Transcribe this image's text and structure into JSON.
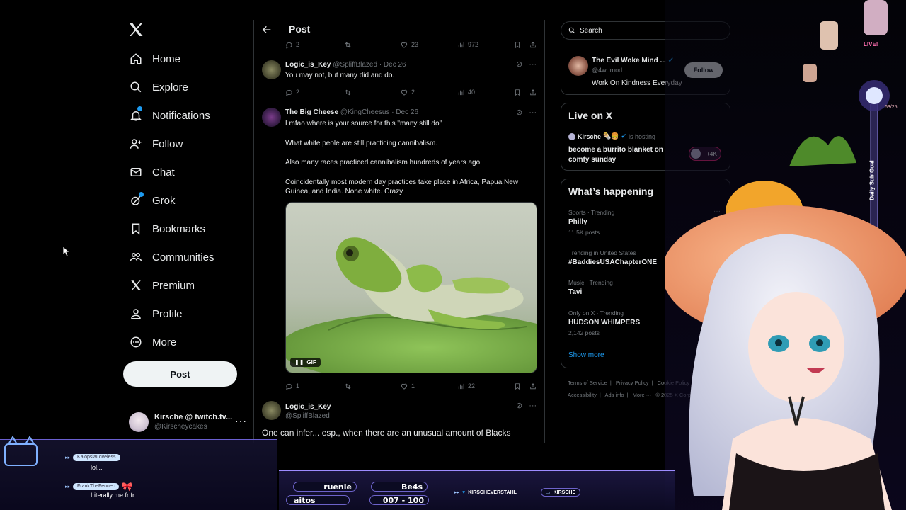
{
  "nav": {
    "items": [
      {
        "label": "Home",
        "icon": "home-icon"
      },
      {
        "label": "Explore",
        "icon": "search-icon"
      },
      {
        "label": "Notifications",
        "icon": "bell-icon",
        "badge": "1"
      },
      {
        "label": "Follow",
        "icon": "follow-icon"
      },
      {
        "label": "Chat",
        "icon": "mail-icon"
      },
      {
        "label": "Grok",
        "icon": "grok-icon"
      },
      {
        "label": "Bookmarks",
        "icon": "bookmark-icon"
      },
      {
        "label": "Communities",
        "icon": "communities-icon"
      },
      {
        "label": "Premium",
        "icon": "x-logo-icon"
      },
      {
        "label": "Profile",
        "icon": "person-icon"
      },
      {
        "label": "More",
        "icon": "more-circle-icon"
      }
    ],
    "post_label": "Post",
    "account": {
      "name": "Kirsche @ twitch.tv...",
      "handle": "@Kirscheycakes"
    }
  },
  "header": {
    "title": "Post"
  },
  "top_actions": {
    "replies": "2",
    "reposts": "",
    "likes": "23",
    "views": "972"
  },
  "tweets": [
    {
      "name": "Logic_is_Key",
      "meta": "@SpliffBlazed · Dec 26",
      "text": "You may not, but many did and do.",
      "actions": {
        "replies": "2",
        "likes": "2",
        "views": "40"
      }
    },
    {
      "name": "The Big Cheese",
      "meta": "@KingCheesus · Dec 26",
      "paragraphs": [
        "Lmfao where is your source for this \"many still do\"",
        "What white peole are still practicing cannibalism.",
        "Also many races practiced cannibalism hundreds of years ago.",
        "Coincidentally most modern day practices take place in Africa, Papua New Guinea, and India. None white. Crazy"
      ],
      "gif_label": "GIF",
      "actions": {
        "replies": "1",
        "likes": "1",
        "views": "22"
      }
    },
    {
      "name": "Logic_is_Key",
      "meta": "@SpliffBlazed",
      "text": "One can infer... esp., when there are an unusual amount of Blacks"
    }
  ],
  "search": {
    "placeholder": "Search"
  },
  "who_to_follow": {
    "name": "The Evil Woke Mind ...",
    "handle": "@4wdmod",
    "bio": "Work On Kindness Everyday",
    "follow_label": "Follow"
  },
  "live": {
    "title": "Live on X",
    "host": "Kirsche",
    "hosting_label": "is hosting",
    "space_title": "become a burrito blanket on comfy sunday",
    "listeners": "+4K"
  },
  "happening": {
    "title": "What’s happening",
    "trends": [
      {
        "category": "Sports · Trending",
        "name": "Philly",
        "count": "11.5K posts"
      },
      {
        "category": "Trending in United States",
        "name": "#BaddiesUSAChapterONE",
        "count": ""
      },
      {
        "category": "Music · Trending",
        "name": "Tavi",
        "count": ""
      },
      {
        "category": "Only on X · Trending",
        "name": "HUDSON WHIMPERS",
        "count": "2,142 posts"
      }
    ],
    "show_more": "Show more"
  },
  "footer": {
    "links": [
      "Terms of Service",
      "|",
      "Privacy Policy",
      "|",
      "Cookie Policy",
      "|",
      "Accessibility",
      "|",
      "Ads info",
      "|",
      "More ···",
      "© 2025 X Corp."
    ]
  },
  "stream": {
    "chat": [
      {
        "user": "KalopsiaLoveless",
        "message": "lol..."
      },
      {
        "user": "FrankTheFennec",
        "message": "Literally me fr fr"
      }
    ],
    "bar": {
      "name1": "ruenie",
      "name2": "Be4s",
      "name3": "aitos",
      "score": "007 - 100",
      "twitter_tag": "KIRSCHEVERSTAHL",
      "discord_tag": "KIRSCHE"
    },
    "goal_label": "Daily Sub Goal",
    "goal_count": "63/25",
    "live_label": "LIVE!"
  },
  "colors": {
    "accent": "#1d9bf0",
    "border": "#2f3336",
    "muted": "#71767b",
    "overlay": "#6d63c9"
  }
}
